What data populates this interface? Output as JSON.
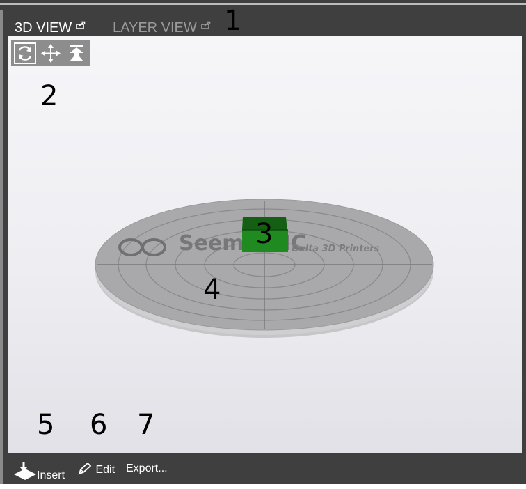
{
  "tabs": {
    "view3d": {
      "label": "3D VIEW",
      "icon": "popout-icon"
    },
    "layer": {
      "label": "LAYER VIEW",
      "icon": "popout-icon"
    }
  },
  "toolbox": {
    "items": [
      {
        "name": "rotate-icon",
        "active": true
      },
      {
        "name": "move-icon",
        "active": false
      },
      {
        "name": "drop-to-bed-icon",
        "active": false
      }
    ]
  },
  "scene": {
    "bed_logo_text": "SeemeCNC",
    "bed_logo_subtext": "Delta 3D Printers",
    "object_color": "#1f8a1f",
    "bed_color": "#a9a9ab"
  },
  "callouts": {
    "c1": "1",
    "c2": "2",
    "c3": "3",
    "c4": "4",
    "c5": "5",
    "c6": "6",
    "c7": "7"
  },
  "actions": {
    "insert": "Insert",
    "edit": "Edit",
    "export": "Export..."
  },
  "colors": {
    "chrome": "#3f3f3f",
    "active_tab": "#ffffff",
    "inactive_tab": "#9a9a9a",
    "toolbox": "#8d8d8d"
  }
}
